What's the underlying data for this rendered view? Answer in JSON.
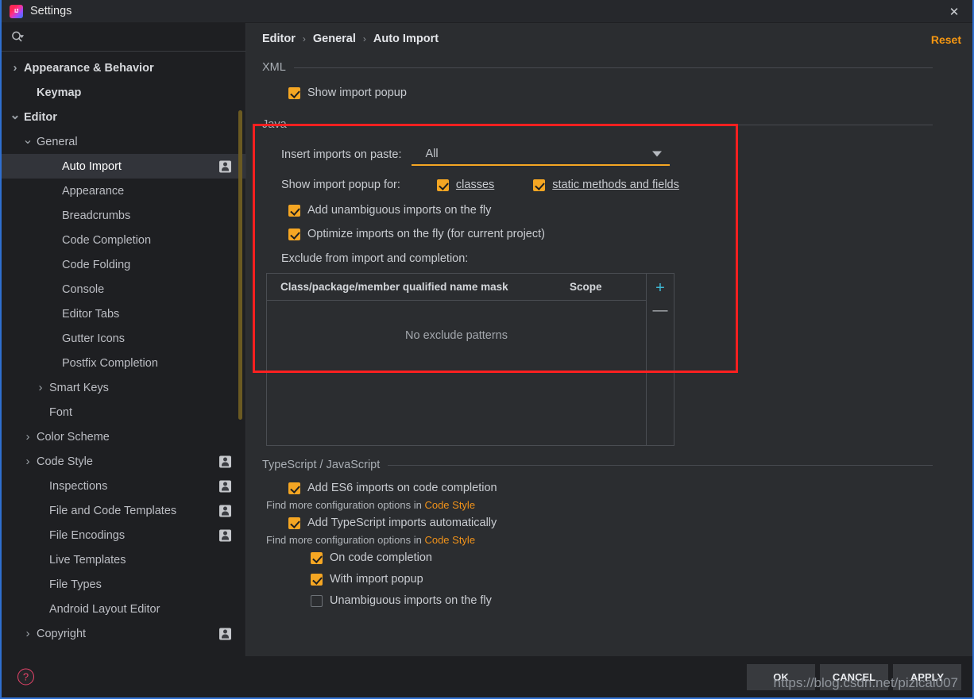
{
  "window": {
    "title": "Settings",
    "app_icon": "intellij-idea-icon",
    "close_icon": "close-icon"
  },
  "sidebar": {
    "search": {
      "placeholder": "",
      "value": "",
      "icon": "search-icon"
    },
    "items": [
      {
        "label": "Appearance & Behavior",
        "indent": 0,
        "arrow": "chevron-right",
        "bold": true,
        "selected": false,
        "profile": false
      },
      {
        "label": "Keymap",
        "indent": 1,
        "arrow": "",
        "bold": true,
        "selected": false,
        "profile": false
      },
      {
        "label": "Editor",
        "indent": 0,
        "arrow": "chevron-down",
        "bold": true,
        "selected": false,
        "profile": false
      },
      {
        "label": "General",
        "indent": 1,
        "arrow": "chevron-down",
        "bold": false,
        "selected": false,
        "profile": false
      },
      {
        "label": "Auto Import",
        "indent": 3,
        "arrow": "",
        "bold": false,
        "selected": true,
        "profile": true
      },
      {
        "label": "Appearance",
        "indent": 3,
        "arrow": "",
        "bold": false,
        "selected": false,
        "profile": false
      },
      {
        "label": "Breadcrumbs",
        "indent": 3,
        "arrow": "",
        "bold": false,
        "selected": false,
        "profile": false
      },
      {
        "label": "Code Completion",
        "indent": 3,
        "arrow": "",
        "bold": false,
        "selected": false,
        "profile": false
      },
      {
        "label": "Code Folding",
        "indent": 3,
        "arrow": "",
        "bold": false,
        "selected": false,
        "profile": false
      },
      {
        "label": "Console",
        "indent": 3,
        "arrow": "",
        "bold": false,
        "selected": false,
        "profile": false
      },
      {
        "label": "Editor Tabs",
        "indent": 3,
        "arrow": "",
        "bold": false,
        "selected": false,
        "profile": false
      },
      {
        "label": "Gutter Icons",
        "indent": 3,
        "arrow": "",
        "bold": false,
        "selected": false,
        "profile": false
      },
      {
        "label": "Postfix Completion",
        "indent": 3,
        "arrow": "",
        "bold": false,
        "selected": false,
        "profile": false
      },
      {
        "label": "Smart Keys",
        "indent": 2,
        "arrow": "chevron-right",
        "bold": false,
        "selected": false,
        "profile": false
      },
      {
        "label": "Font",
        "indent": 2,
        "arrow": "",
        "bold": false,
        "selected": false,
        "profile": false
      },
      {
        "label": "Color Scheme",
        "indent": 1,
        "arrow": "chevron-right",
        "bold": false,
        "selected": false,
        "profile": false
      },
      {
        "label": "Code Style",
        "indent": 1,
        "arrow": "chevron-right",
        "bold": false,
        "selected": false,
        "profile": true
      },
      {
        "label": "Inspections",
        "indent": 2,
        "arrow": "",
        "bold": false,
        "selected": false,
        "profile": true
      },
      {
        "label": "File and Code Templates",
        "indent": 2,
        "arrow": "",
        "bold": false,
        "selected": false,
        "profile": true
      },
      {
        "label": "File Encodings",
        "indent": 2,
        "arrow": "",
        "bold": false,
        "selected": false,
        "profile": true
      },
      {
        "label": "Live Templates",
        "indent": 2,
        "arrow": "",
        "bold": false,
        "selected": false,
        "profile": false
      },
      {
        "label": "File Types",
        "indent": 2,
        "arrow": "",
        "bold": false,
        "selected": false,
        "profile": false
      },
      {
        "label": "Android Layout Editor",
        "indent": 2,
        "arrow": "",
        "bold": false,
        "selected": false,
        "profile": false
      },
      {
        "label": "Copyright",
        "indent": 1,
        "arrow": "chevron-right",
        "bold": false,
        "selected": false,
        "profile": true
      }
    ]
  },
  "header": {
    "breadcrumb": [
      "Editor",
      "General",
      "Auto Import"
    ],
    "separator": "›",
    "reset_label": "Reset"
  },
  "sections": {
    "xml": {
      "title": "XML",
      "show_import_popup": {
        "label": "Show import popup",
        "checked": true
      }
    },
    "java": {
      "title": "Java",
      "insert_imports_label": "Insert imports on paste:",
      "insert_imports_value": "All",
      "show_popup_for_label": "Show import popup for:",
      "classes": {
        "label": "classes",
        "checked": true
      },
      "static_methods": {
        "label": "static methods and fields",
        "checked": true
      },
      "add_unambiguous": {
        "label": "Add unambiguous imports on the fly",
        "checked": true
      },
      "optimize_imports": {
        "label": "Optimize imports on the fly (for current project)",
        "checked": true
      },
      "exclude_label": "Exclude from import and completion:",
      "table": {
        "columns": [
          "Class/package/member qualified name mask",
          "Scope"
        ],
        "rows": [],
        "empty_text": "No exclude patterns",
        "add_icon": "plus-icon",
        "remove_icon": "minus-icon"
      }
    },
    "ts_js": {
      "title": "TypeScript / JavaScript",
      "add_es6": {
        "label": "Add ES6 imports on code completion",
        "checked": true
      },
      "hint1_prefix": "Find more configuration options in ",
      "hint1_link": "Code Style",
      "add_ts": {
        "label": "Add TypeScript imports automatically",
        "checked": true
      },
      "hint2_prefix": "Find more configuration options in ",
      "hint2_link": "Code Style",
      "on_code_completion": {
        "label": "On code completion",
        "checked": true
      },
      "with_import_popup": {
        "label": "With import popup",
        "checked": true
      },
      "unambiguous_fly": {
        "label": "Unambiguous imports on the fly",
        "checked": false
      }
    }
  },
  "footer": {
    "help_icon": "help-question-icon",
    "ok": "OK",
    "cancel": "CANCEL",
    "apply": "APPLY"
  },
  "watermark": "https://blog.csdn.net/pizicai007",
  "colors": {
    "accent_orange": "#f5a623",
    "link_orange": "#f0921a",
    "annotation_red": "#fe2020",
    "plus_cyan": "#3fb8d4",
    "window_border_blue": "#2f6fd0"
  }
}
